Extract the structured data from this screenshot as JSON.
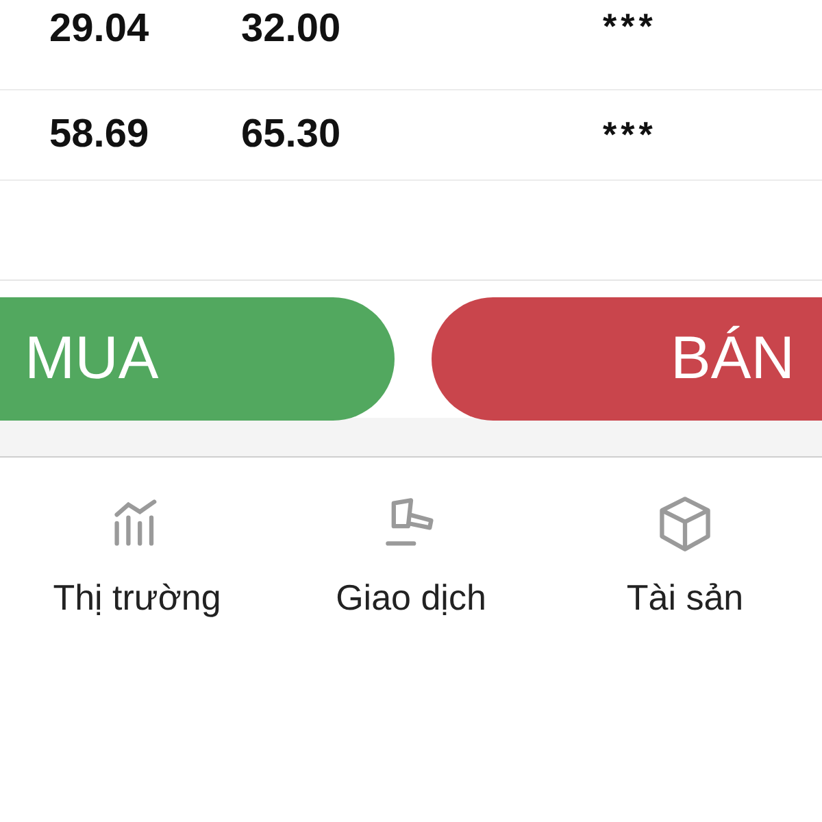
{
  "rows": [
    {
      "column_1": "29.04",
      "column_2": "32.00",
      "column_3": "***"
    },
    {
      "column_1": "58.69",
      "column_2": "65.30",
      "column_3": "***"
    }
  ],
  "actions": [
    {
      "label": "MUA",
      "kind": "buy"
    },
    {
      "label": "BÁN",
      "kind": "sell"
    }
  ],
  "bottom_nav": [
    {
      "label": "Thị trường"
    },
    {
      "label": "Giao dịch"
    },
    {
      "label": "Tài sản"
    }
  ]
}
